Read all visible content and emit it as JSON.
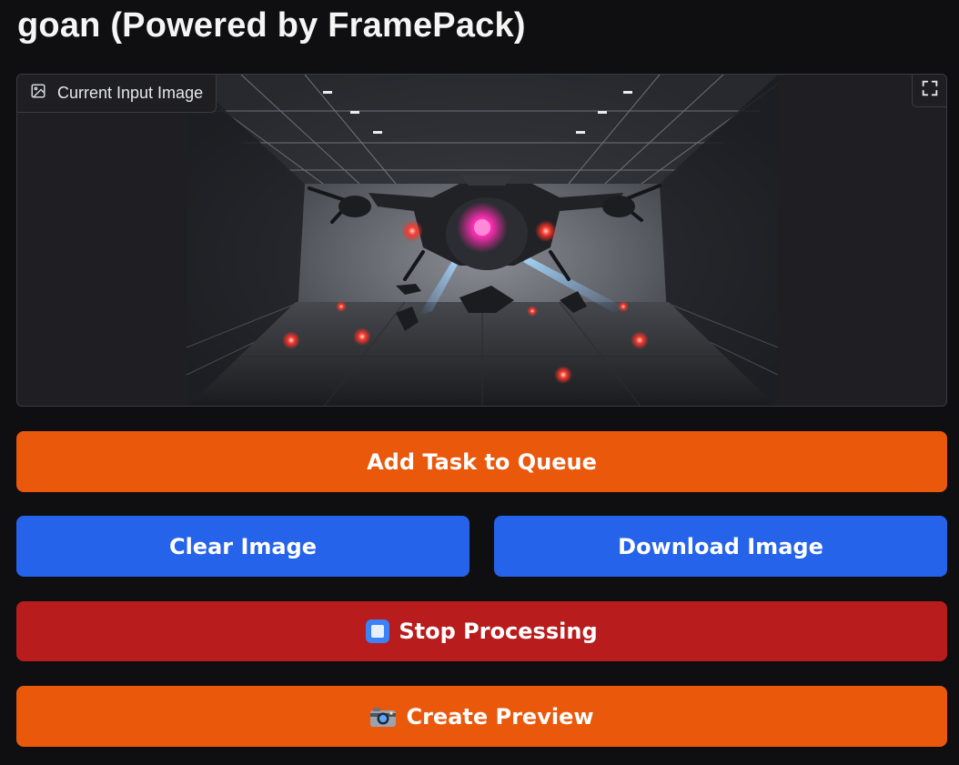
{
  "app": {
    "title": "goan (Powered by FramePack)"
  },
  "input_image": {
    "label": "Current Input Image",
    "label_icon": "image-icon",
    "fullscreen_icon": "fullscreen-icon"
  },
  "buttons": {
    "add_task": "Add Task to Queue",
    "clear_image": "Clear Image",
    "download_image": "Download Image",
    "stop_processing": "Stop Processing",
    "stop_icon": "stop-button-icon",
    "create_preview": "Create Preview",
    "preview_icon": "camera-icon"
  },
  "colors": {
    "background": "#0f0f11",
    "orange": "#ea580c",
    "blue": "#2563eb",
    "red": "#b91c1c"
  }
}
